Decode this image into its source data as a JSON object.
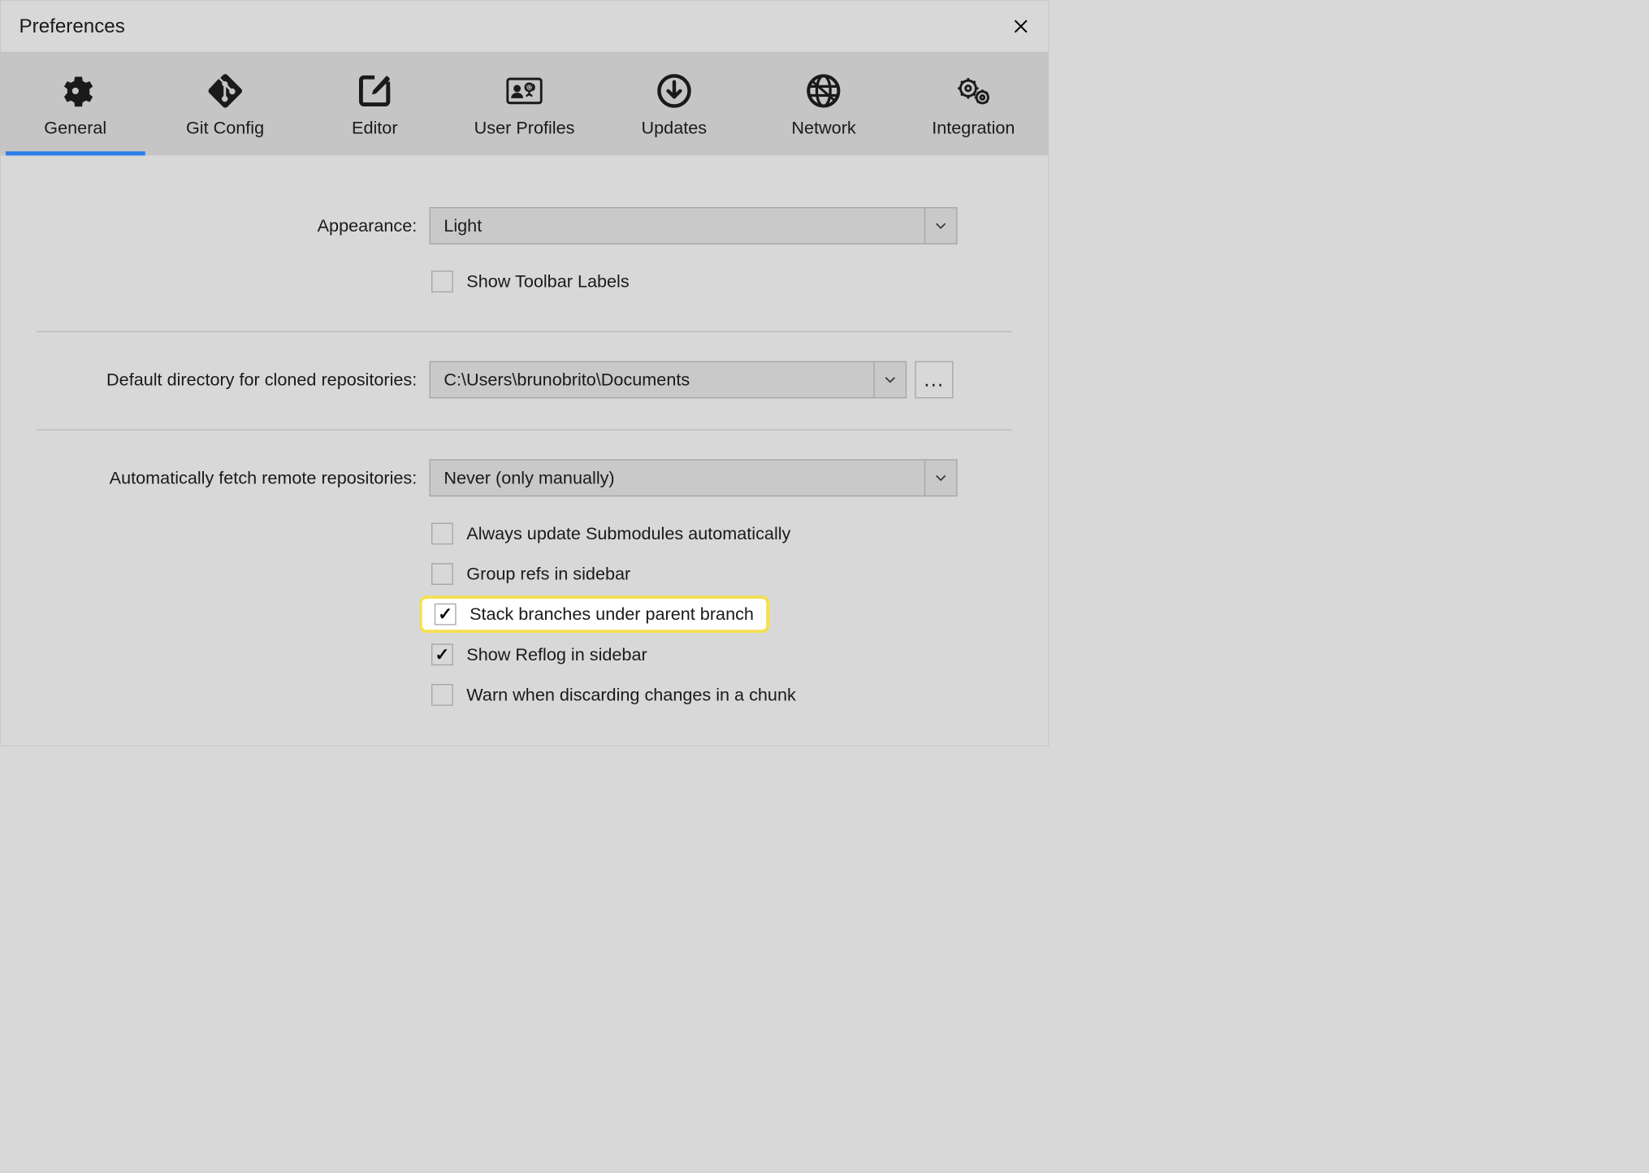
{
  "window_title": "Preferences",
  "tabs": {
    "general": "General",
    "git_config": "Git Config",
    "editor": "Editor",
    "user_profiles": "User Profiles",
    "updates": "Updates",
    "network": "Network",
    "integration": "Integration"
  },
  "appearance": {
    "label": "Appearance:",
    "value": "Light",
    "show_toolbar_labels": "Show Toolbar Labels"
  },
  "clone_dir": {
    "label": "Default directory for cloned repositories:",
    "value": "C:\\Users\\brunobrito\\Documents",
    "browse": "..."
  },
  "fetch": {
    "label": "Automatically fetch remote repositories:",
    "value": "Never (only manually)"
  },
  "checkboxes": {
    "always_update_submodules": "Always update Submodules automatically",
    "group_refs": "Group refs in sidebar",
    "stack_branches": "Stack branches under parent branch",
    "show_reflog": "Show Reflog in sidebar",
    "warn_discard": "Warn when discarding changes in a chunk"
  }
}
